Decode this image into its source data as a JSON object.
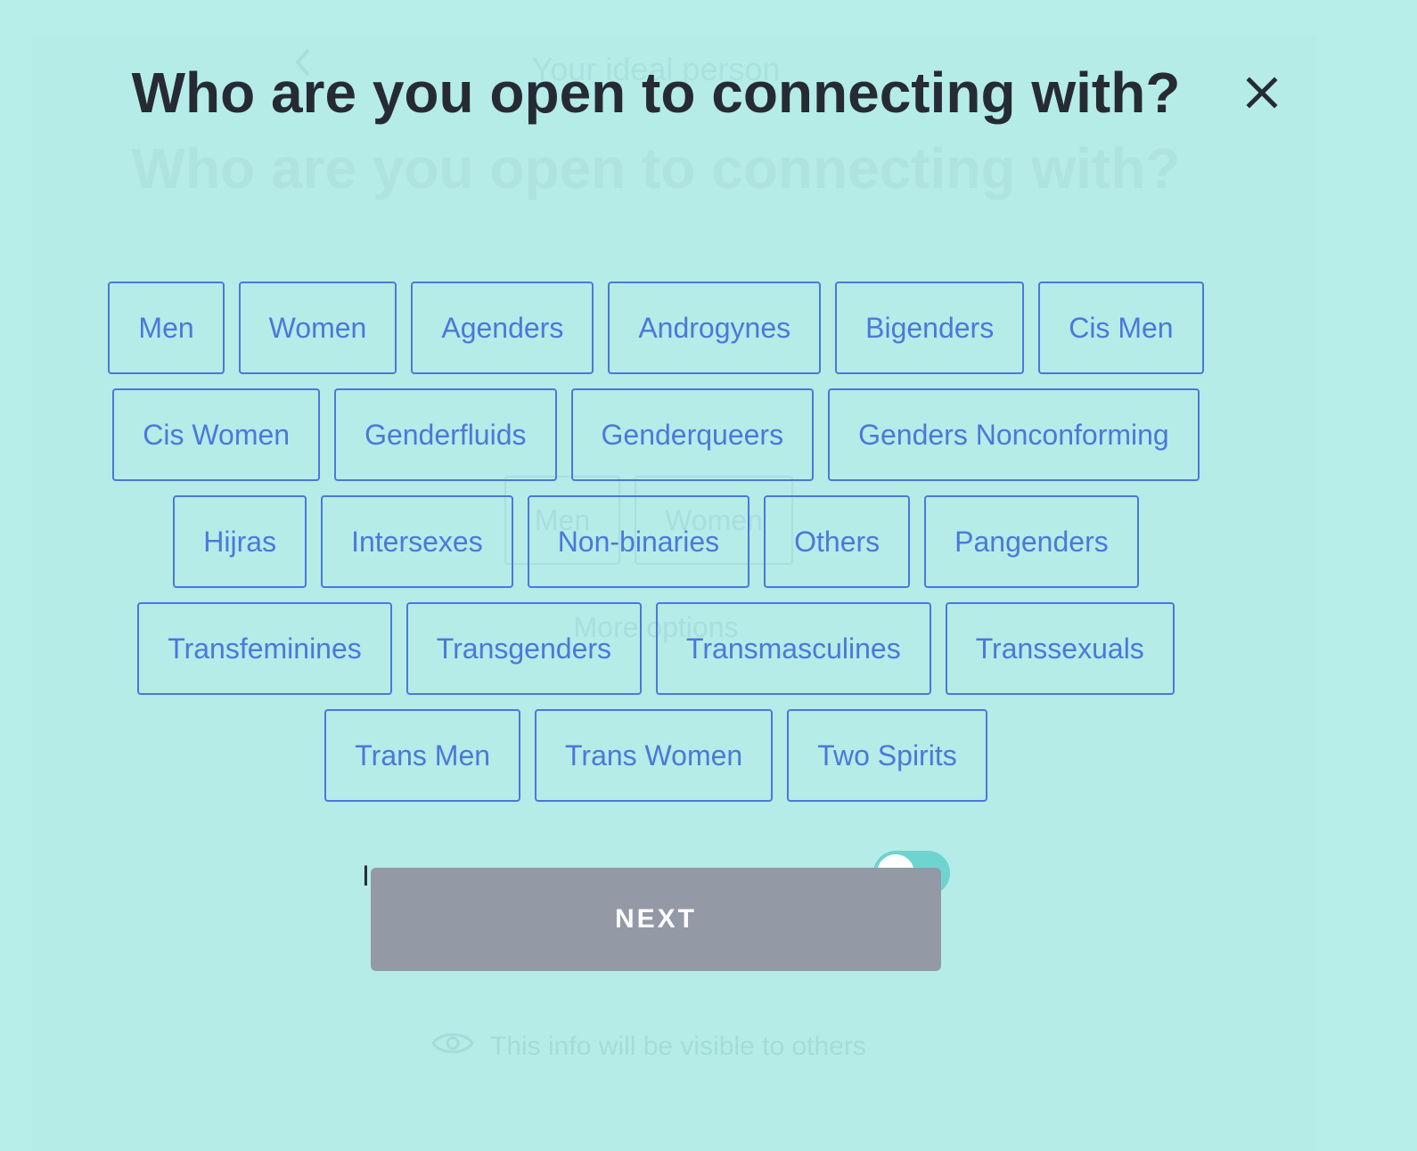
{
  "background_page": {
    "back_icon": "chevron-left-icon",
    "header_title": "Your ideal person",
    "heading": "Who are you open to connecting with?",
    "chips": [
      "Men",
      "Women"
    ],
    "more_options": "More options",
    "partial_label": "I",
    "toggle_state": "on",
    "visibility_icon": "eye-icon",
    "visibility_text": "This info will be visible to others"
  },
  "modal": {
    "title": "Who are you open to connecting with?",
    "close_icon": "close-icon",
    "options": [
      [
        "Men",
        "Women",
        "Agenders",
        "Androgynes",
        "Bigenders",
        "Cis Men"
      ],
      [
        "Cis Women",
        "Genderfluids",
        "Genderqueers",
        "Genders Nonconforming"
      ],
      [
        "Hijras",
        "Intersexes",
        "Non-binaries",
        "Others",
        "Pangenders"
      ],
      [
        "Transfeminines",
        "Transgenders",
        "Transmasculines",
        "Transsexuals"
      ],
      [
        "Trans Men",
        "Trans Women",
        "Two Spirits"
      ]
    ],
    "next_label": "NEXT"
  },
  "colors": {
    "background": "#b8eeea",
    "chip_border": "#4b78db",
    "chip_text": "#4b78db",
    "title_text": "#262b33",
    "next_button": "#939aa6",
    "toggle": "#6fd3cf"
  }
}
